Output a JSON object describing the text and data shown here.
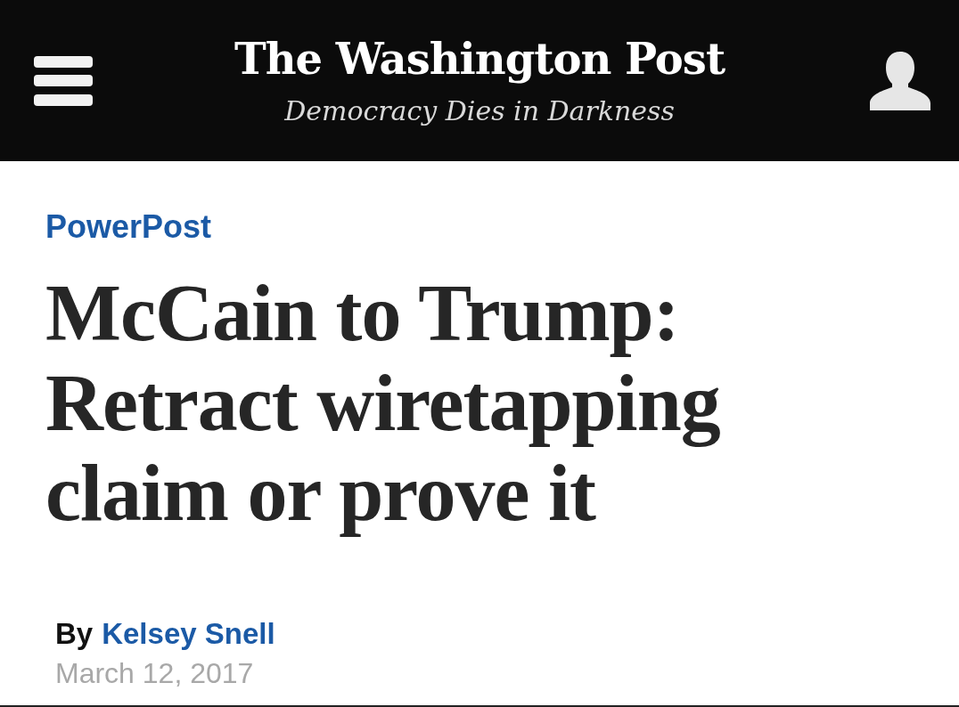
{
  "header": {
    "logo": "The Washington Post",
    "tagline": "Democracy Dies in Darkness"
  },
  "article": {
    "section": "PowerPost",
    "headline": "McCain to Trump: Retract wiretapping claim or prove it",
    "byline": {
      "prefix": "By",
      "author": "Kelsey Snell"
    },
    "date": "March 12, 2017"
  }
}
